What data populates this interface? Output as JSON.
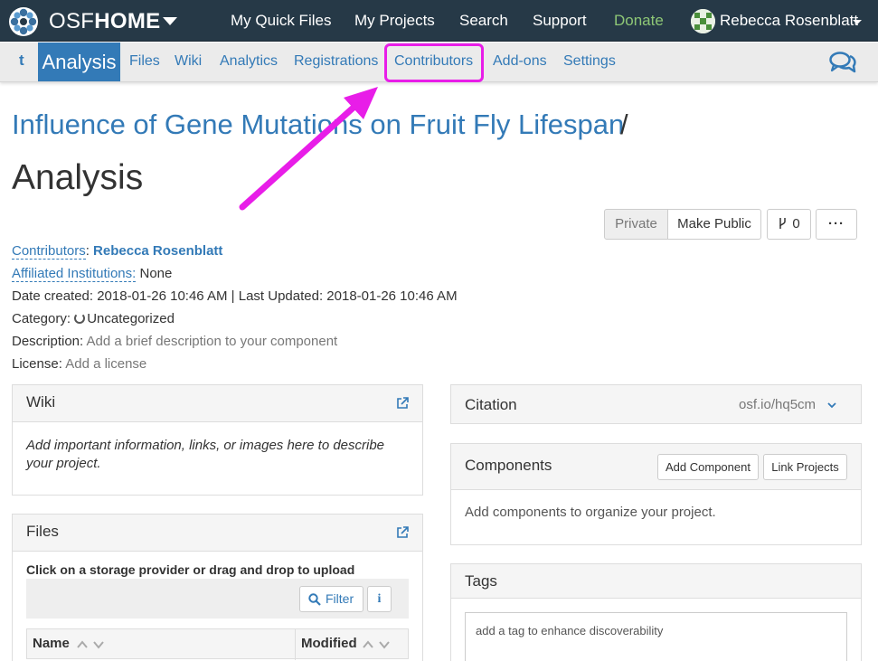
{
  "topbar": {
    "brand_light": "OSF",
    "brand_bold": "HOME",
    "nav": [
      "My Quick Files",
      "My Projects",
      "Search",
      "Support",
      "Donate"
    ],
    "user": "Rebecca Rosenblatt"
  },
  "subnav": {
    "back": "t",
    "active": "Analysis",
    "items": [
      "Files",
      "Wiki",
      "Analytics",
      "Registrations",
      "Contributors",
      "Add-ons",
      "Settings"
    ]
  },
  "project": {
    "parent_title": "Influence of Gene Mutations on Fruit Fly Lifespan",
    "separator": "/",
    "title": "Analysis"
  },
  "actions": {
    "private": "Private",
    "make_public": "Make Public",
    "fork_count": "0",
    "more": "···"
  },
  "meta": {
    "contributors_label": "Contributors",
    "contributors_value": "Rebecca Rosenblatt",
    "institutions_label": "Affiliated Institutions:",
    "institutions_value": "None",
    "dates": "Date created: 2018-01-26 10:46 AM | Last Updated: 2018-01-26 10:46 AM",
    "category_label": "Category:",
    "category_value": "Uncategorized",
    "description_label": "Description:",
    "description_value": "Add a brief description to your component",
    "license_label": "License:",
    "license_value": "Add a license"
  },
  "wiki": {
    "title": "Wiki",
    "body": "Add important information, links, or images here to describe your project."
  },
  "files": {
    "title": "Files",
    "instructions": "Click on a storage provider or drag and drop to upload",
    "filter": "Filter",
    "info": "i",
    "col_name": "Name",
    "col_modified": "Modified"
  },
  "citation": {
    "title": "Citation",
    "link": "osf.io/hq5cm"
  },
  "components": {
    "title": "Components",
    "add": "Add Component",
    "link": "Link Projects",
    "body": "Add components to organize your project."
  },
  "tags": {
    "title": "Tags",
    "placeholder": "add a tag to enhance discoverability"
  },
  "colors": {
    "navbar": "#263947",
    "link": "#337ab7",
    "donate": "#8ec776",
    "highlight": "#e81de8"
  }
}
